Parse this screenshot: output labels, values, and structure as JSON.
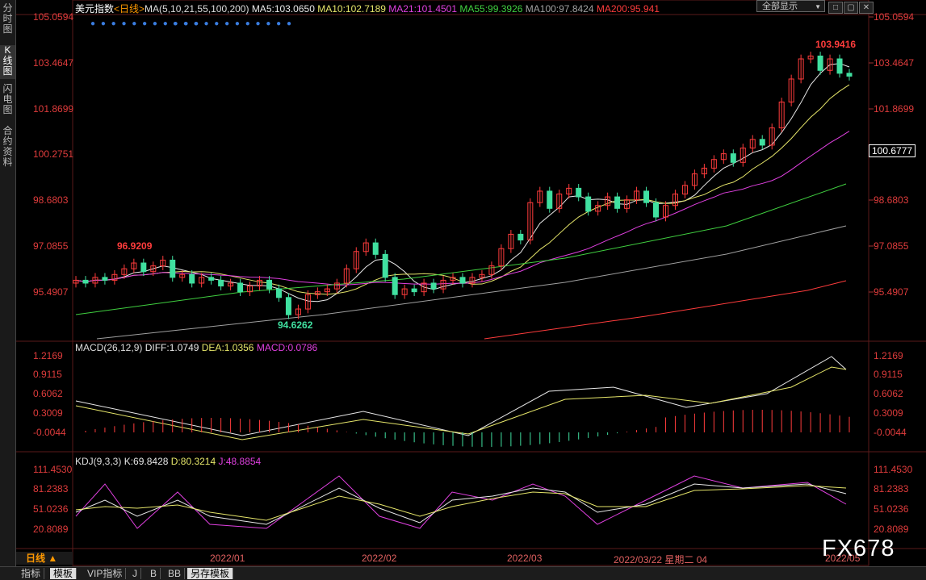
{
  "sidebar": {
    "tabs": [
      {
        "label": "分时图",
        "active": false
      },
      {
        "label": "K线图",
        "active": true
      },
      {
        "label": "闪电图",
        "active": false
      },
      {
        "label": "合约资料",
        "active": false
      }
    ]
  },
  "header": {
    "instrument": "美元指数",
    "period": "<日线>",
    "ma_title": "MA(5,10,21,55,100,200)",
    "ma_items": [
      {
        "label": "MA5:103.0650",
        "color": "#e8e8e8"
      },
      {
        "label": "MA10:102.7189",
        "color": "#e6e66a"
      },
      {
        "label": "MA21:101.4501",
        "color": "#e040e0"
      },
      {
        "label": "MA55:99.3926",
        "color": "#40d040"
      },
      {
        "label": "MA100:97.8424",
        "color": "#a0a0a0"
      },
      {
        "label": "MA200:95.941",
        "color": "#ff3c3c"
      }
    ],
    "dropdown": "全部显示",
    "dropdown_arrow": "▼"
  },
  "price_axis": [
    "105.0594",
    "103.4647",
    "101.8699",
    "100.2751",
    "98.6803",
    "97.0855",
    "95.4907"
  ],
  "current_price": "100.6777",
  "annotations": {
    "high": "103.9416",
    "mid_high": "96.9209",
    "low": "94.6262"
  },
  "macd": {
    "title": "MACD(26,12,9)",
    "diff": "DIFF:1.0749",
    "dea": "DEA:1.0356",
    "macd": "MACD:0.0786",
    "axis": [
      "1.2169",
      "0.9115",
      "0.6062",
      "0.3009",
      "-0.0044"
    ]
  },
  "kdj": {
    "title": "KDJ(9,3,3)",
    "k": "K:69.8428",
    "d": "D:80.3214",
    "j": "J:48.8854",
    "axis": [
      "111.4530",
      "81.2383",
      "51.0236",
      "20.8089"
    ]
  },
  "time_axis": {
    "labels": [
      "2022/01",
      "2022/02",
      "2022/03",
      "2022/03/22 星期二 04",
      "2022/05"
    ],
    "period_btn": "日线 ▲"
  },
  "watermark": "FX678",
  "bottom_tabs": [
    {
      "label": "指标",
      "selected": false
    },
    {
      "label": "模板",
      "selected": true
    },
    {
      "label": "VIP指标",
      "selected": false
    },
    {
      "label": "J",
      "selected": false
    },
    {
      "label": "B",
      "selected": false
    },
    {
      "label": "BB",
      "selected": false
    },
    {
      "label": "另存模板",
      "selected": false
    }
  ],
  "colors": {
    "up": "#ff3c3c",
    "down": "#40e0a0",
    "grid": "#5a1a1a"
  }
}
